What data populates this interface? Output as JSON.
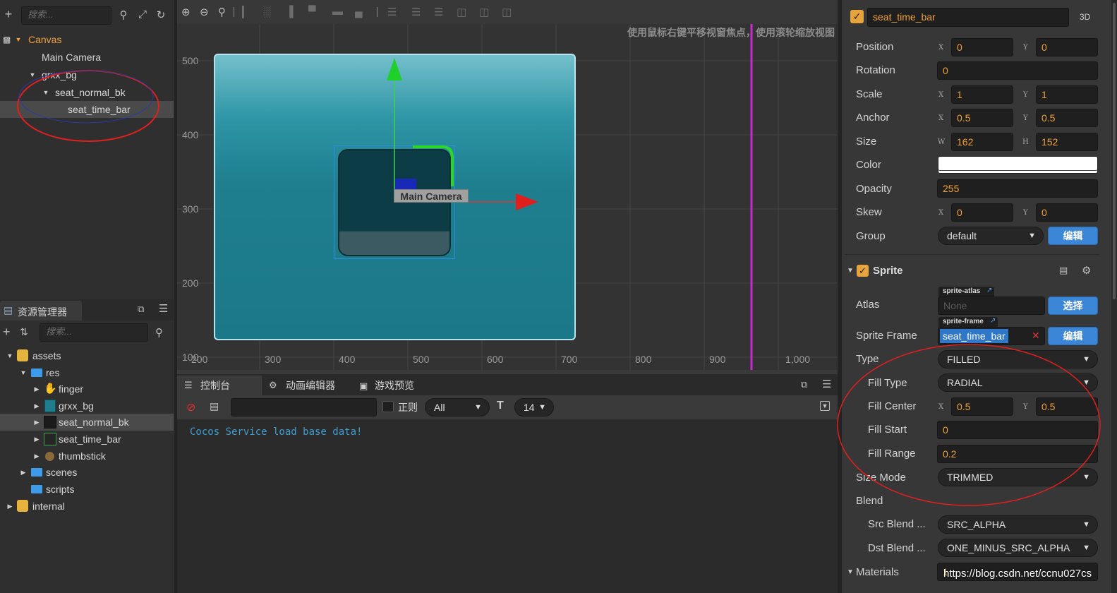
{
  "hierarchy": {
    "search_placeholder": "搜索...",
    "items": [
      {
        "label": "Canvas"
      },
      {
        "label": "Main Camera"
      },
      {
        "label": "grxx_bg"
      },
      {
        "label": "seat_normal_bk"
      },
      {
        "label": "seat_time_bar"
      }
    ]
  },
  "assets": {
    "title": "资源管理器",
    "search_placeholder": "搜索...",
    "items": [
      {
        "label": "assets"
      },
      {
        "label": "res"
      },
      {
        "label": "finger"
      },
      {
        "label": "grxx_bg"
      },
      {
        "label": "seat_normal_bk"
      },
      {
        "label": "seat_time_bar"
      },
      {
        "label": "thumbstick"
      },
      {
        "label": "scenes"
      },
      {
        "label": "scripts"
      },
      {
        "label": "internal"
      }
    ]
  },
  "scene": {
    "hint": "使用鼠标右键平移视窗焦点，使用滚轮缩放视图",
    "camera_label": "Main Camera",
    "y_ticks": [
      "500",
      "400",
      "300",
      "200",
      "100"
    ],
    "x_ticks": [
      "200",
      "300",
      "400",
      "500",
      "600",
      "700",
      "800",
      "900",
      "1,000"
    ]
  },
  "console": {
    "tabs": [
      {
        "label": "控制台"
      },
      {
        "label": "动画编辑器"
      },
      {
        "label": "游戏预览"
      }
    ],
    "regex_label": "正则",
    "filter_value": "All",
    "font_size_value": "14",
    "log": "Cocos Service load base data!"
  },
  "inspector": {
    "node_name": "seat_time_bar",
    "mode_3d": "3D",
    "props": {
      "position": {
        "label": "Position",
        "x": "0",
        "y": "0"
      },
      "rotation": {
        "label": "Rotation",
        "value": "0"
      },
      "scale": {
        "label": "Scale",
        "x": "1",
        "y": "1"
      },
      "anchor": {
        "label": "Anchor",
        "x": "0.5",
        "y": "0.5"
      },
      "size": {
        "label": "Size",
        "w": "162",
        "h": "152"
      },
      "color": {
        "label": "Color",
        "value": "#ffffff"
      },
      "opacity": {
        "label": "Opacity",
        "value": "255"
      },
      "skew": {
        "label": "Skew",
        "x": "0",
        "y": "0"
      },
      "group": {
        "label": "Group",
        "value": "default",
        "edit": "编辑"
      }
    },
    "axis": {
      "x": "X",
      "y": "Y",
      "w": "W",
      "h": "H"
    },
    "sprite": {
      "title": "Sprite",
      "atlas": {
        "label": "Atlas",
        "tag": "sprite-atlas",
        "value": "None",
        "button": "选择"
      },
      "frame": {
        "label": "Sprite Frame",
        "tag": "sprite-frame",
        "value": "seat_time_bar",
        "button": "编辑"
      },
      "type": {
        "label": "Type",
        "value": "FILLED"
      },
      "fill_type": {
        "label": "Fill Type",
        "value": "RADIAL"
      },
      "fill_center": {
        "label": "Fill Center",
        "x": "0.5",
        "y": "0.5"
      },
      "fill_start": {
        "label": "Fill Start",
        "value": "0"
      },
      "fill_range": {
        "label": "Fill Range",
        "value": "0.2"
      },
      "size_mode": {
        "label": "Size Mode",
        "value": "TRIMMED"
      },
      "blend": {
        "label": "Blend"
      },
      "src_blend": {
        "label": "Src Blend ...",
        "value": "SRC_ALPHA"
      },
      "dst_blend": {
        "label": "Dst Blend ...",
        "value": "ONE_MINUS_SRC_ALPHA"
      },
      "materials": {
        "label": "Materials",
        "value": "1"
      }
    },
    "watermark": "https://blog.csdn.net/ccnu027cs"
  },
  "colors": {
    "accent_orange": "#f0a13a",
    "selection_blue": "#3b86d6",
    "annotation_red": "#e0201e",
    "scene_teal": "#1e7d8c"
  }
}
